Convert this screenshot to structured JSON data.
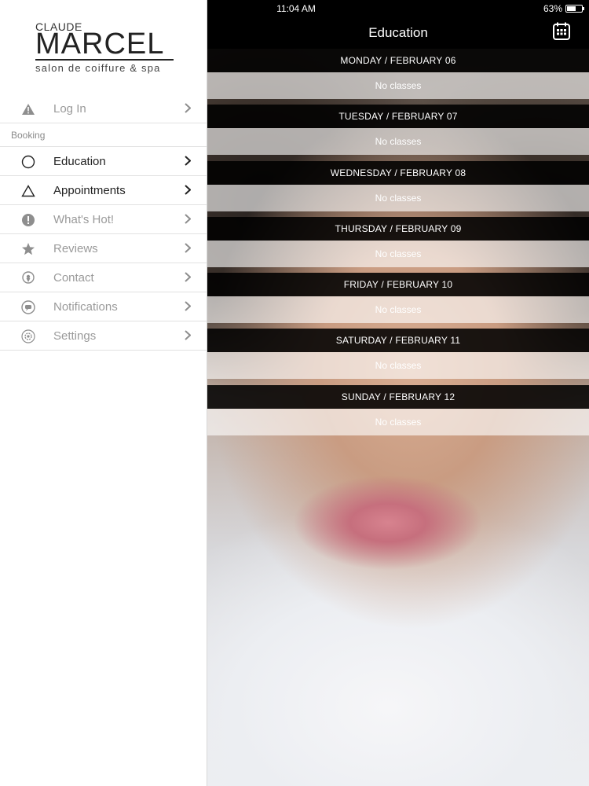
{
  "status_bar": {
    "time": "11:04 AM",
    "battery": "63%",
    "battery_level": 0.63
  },
  "logo": {
    "line1": "CLAUDE",
    "line2": "MARCEL",
    "line3": "salon de coiffure & spa"
  },
  "sidebar": {
    "login": {
      "label": "Log In",
      "icon": "warning-icon"
    },
    "section_label": "Booking",
    "items": [
      {
        "label": "Education",
        "icon": "circle-icon",
        "active": true
      },
      {
        "label": "Appointments",
        "icon": "triangle-icon",
        "active": true
      },
      {
        "label": "What's Hot!",
        "icon": "exclamation-icon",
        "active": false
      },
      {
        "label": "Reviews",
        "icon": "star-icon",
        "active": false
      },
      {
        "label": "Contact",
        "icon": "location-pin-icon",
        "active": false
      },
      {
        "label": "Notifications",
        "icon": "chat-bubble-icon",
        "active": false
      },
      {
        "label": "Settings",
        "icon": "gear-icon",
        "active": false
      }
    ]
  },
  "header": {
    "title": "Education",
    "calendar_icon": "calendar-icon"
  },
  "schedule": [
    {
      "day": "MONDAY / FEBRUARY 06",
      "status": "No classes"
    },
    {
      "day": "TUESDAY / FEBRUARY 07",
      "status": "No classes"
    },
    {
      "day": "WEDNESDAY / FEBRUARY 08",
      "status": "No classes"
    },
    {
      "day": "THURSDAY / FEBRUARY 09",
      "status": "No classes"
    },
    {
      "day": "FRIDAY / FEBRUARY 10",
      "status": "No classes"
    },
    {
      "day": "SATURDAY / FEBRUARY 11",
      "status": "No classes"
    },
    {
      "day": "SUNDAY / FEBRUARY 12",
      "status": "No classes"
    }
  ],
  "colors": {
    "header_bg": "#000000",
    "active_text": "#222222",
    "inactive_text": "#9a9a9a"
  }
}
